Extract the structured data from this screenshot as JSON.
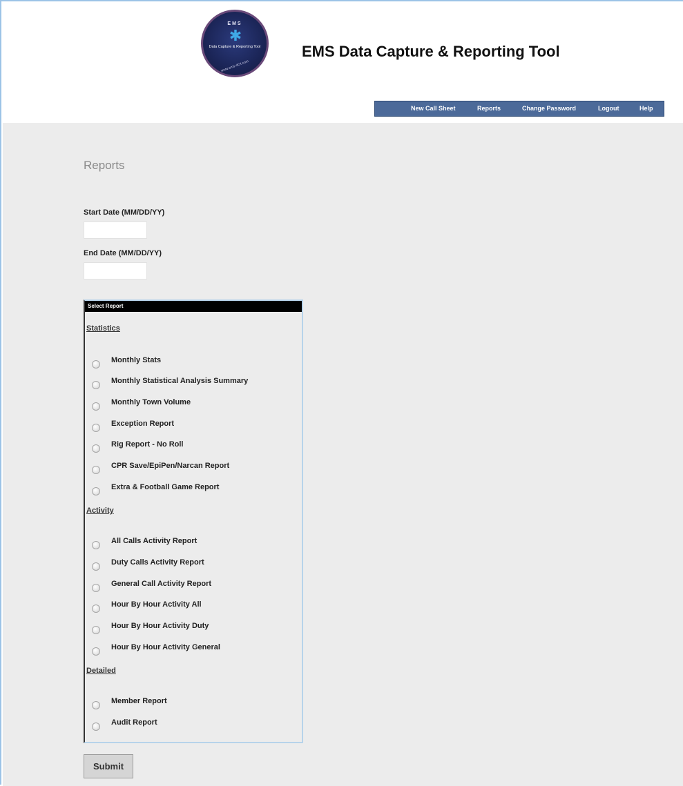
{
  "header": {
    "logo": {
      "top_text": "EMS",
      "caption": "Data Capture & Reporting Tool",
      "url": "www.ems-dcrt.com"
    },
    "title": "EMS Data Capture & Reporting Tool"
  },
  "nav": {
    "items": [
      {
        "label": "New Call Sheet"
      },
      {
        "label": "Reports"
      },
      {
        "label": "Change Password"
      },
      {
        "label": "Logout"
      },
      {
        "label": "Help"
      }
    ]
  },
  "page": {
    "title": "Reports",
    "start_label": "Start Date (MM/DD/YY)",
    "start_value": "",
    "end_label": "End Date (MM/DD/YY)",
    "end_value": ""
  },
  "report_box": {
    "header": "Select Report",
    "sections": [
      {
        "title": "Statistics",
        "options": [
          "Monthly Stats",
          "Monthly Statistical Analysis Summary",
          "Monthly Town Volume",
          "Exception Report",
          "Rig Report - No Roll",
          "CPR Save/EpiPen/Narcan Report",
          "Extra & Football Game Report"
        ]
      },
      {
        "title": "Activity",
        "options": [
          "All Calls Activity Report",
          "Duty Calls Activity Report",
          "General Call Activity Report",
          "Hour By Hour Activity All",
          "Hour By Hour Activity Duty",
          "Hour By Hour Activity General"
        ]
      },
      {
        "title": "Detailed",
        "options": [
          "Member Report",
          "Audit Report"
        ]
      }
    ]
  },
  "submit_label": "Submit",
  "colors": {
    "nav_bg": "#4c6a99",
    "content_bg": "#ececec",
    "box_header_bg": "#000000",
    "page_title": "#8a8a8a"
  }
}
